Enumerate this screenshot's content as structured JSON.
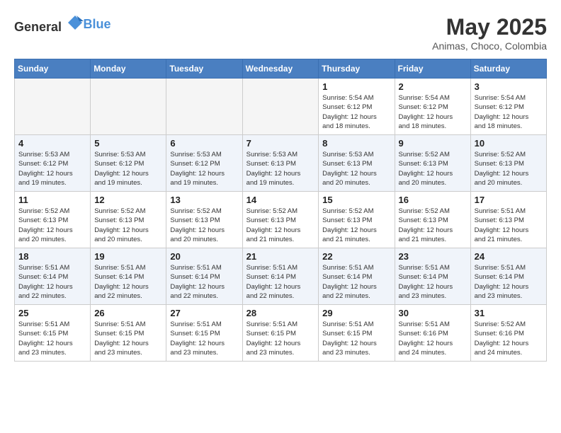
{
  "header": {
    "logo_general": "General",
    "logo_blue": "Blue",
    "title": "May 2025",
    "subtitle": "Animas, Choco, Colombia"
  },
  "weekdays": [
    "Sunday",
    "Monday",
    "Tuesday",
    "Wednesday",
    "Thursday",
    "Friday",
    "Saturday"
  ],
  "weeks": [
    [
      {
        "day": "",
        "info": "",
        "empty": true
      },
      {
        "day": "",
        "info": "",
        "empty": true
      },
      {
        "day": "",
        "info": "",
        "empty": true
      },
      {
        "day": "",
        "info": "",
        "empty": true
      },
      {
        "day": "1",
        "info": "Sunrise: 5:54 AM\nSunset: 6:12 PM\nDaylight: 12 hours\nand 18 minutes."
      },
      {
        "day": "2",
        "info": "Sunrise: 5:54 AM\nSunset: 6:12 PM\nDaylight: 12 hours\nand 18 minutes."
      },
      {
        "day": "3",
        "info": "Sunrise: 5:54 AM\nSunset: 6:12 PM\nDaylight: 12 hours\nand 18 minutes."
      }
    ],
    [
      {
        "day": "4",
        "info": "Sunrise: 5:53 AM\nSunset: 6:12 PM\nDaylight: 12 hours\nand 19 minutes."
      },
      {
        "day": "5",
        "info": "Sunrise: 5:53 AM\nSunset: 6:12 PM\nDaylight: 12 hours\nand 19 minutes."
      },
      {
        "day": "6",
        "info": "Sunrise: 5:53 AM\nSunset: 6:12 PM\nDaylight: 12 hours\nand 19 minutes."
      },
      {
        "day": "7",
        "info": "Sunrise: 5:53 AM\nSunset: 6:13 PM\nDaylight: 12 hours\nand 19 minutes."
      },
      {
        "day": "8",
        "info": "Sunrise: 5:53 AM\nSunset: 6:13 PM\nDaylight: 12 hours\nand 20 minutes."
      },
      {
        "day": "9",
        "info": "Sunrise: 5:52 AM\nSunset: 6:13 PM\nDaylight: 12 hours\nand 20 minutes."
      },
      {
        "day": "10",
        "info": "Sunrise: 5:52 AM\nSunset: 6:13 PM\nDaylight: 12 hours\nand 20 minutes."
      }
    ],
    [
      {
        "day": "11",
        "info": "Sunrise: 5:52 AM\nSunset: 6:13 PM\nDaylight: 12 hours\nand 20 minutes."
      },
      {
        "day": "12",
        "info": "Sunrise: 5:52 AM\nSunset: 6:13 PM\nDaylight: 12 hours\nand 20 minutes."
      },
      {
        "day": "13",
        "info": "Sunrise: 5:52 AM\nSunset: 6:13 PM\nDaylight: 12 hours\nand 20 minutes."
      },
      {
        "day": "14",
        "info": "Sunrise: 5:52 AM\nSunset: 6:13 PM\nDaylight: 12 hours\nand 21 minutes."
      },
      {
        "day": "15",
        "info": "Sunrise: 5:52 AM\nSunset: 6:13 PM\nDaylight: 12 hours\nand 21 minutes."
      },
      {
        "day": "16",
        "info": "Sunrise: 5:52 AM\nSunset: 6:13 PM\nDaylight: 12 hours\nand 21 minutes."
      },
      {
        "day": "17",
        "info": "Sunrise: 5:51 AM\nSunset: 6:13 PM\nDaylight: 12 hours\nand 21 minutes."
      }
    ],
    [
      {
        "day": "18",
        "info": "Sunrise: 5:51 AM\nSunset: 6:14 PM\nDaylight: 12 hours\nand 22 minutes."
      },
      {
        "day": "19",
        "info": "Sunrise: 5:51 AM\nSunset: 6:14 PM\nDaylight: 12 hours\nand 22 minutes."
      },
      {
        "day": "20",
        "info": "Sunrise: 5:51 AM\nSunset: 6:14 PM\nDaylight: 12 hours\nand 22 minutes."
      },
      {
        "day": "21",
        "info": "Sunrise: 5:51 AM\nSunset: 6:14 PM\nDaylight: 12 hours\nand 22 minutes."
      },
      {
        "day": "22",
        "info": "Sunrise: 5:51 AM\nSunset: 6:14 PM\nDaylight: 12 hours\nand 22 minutes."
      },
      {
        "day": "23",
        "info": "Sunrise: 5:51 AM\nSunset: 6:14 PM\nDaylight: 12 hours\nand 23 minutes."
      },
      {
        "day": "24",
        "info": "Sunrise: 5:51 AM\nSunset: 6:14 PM\nDaylight: 12 hours\nand 23 minutes."
      }
    ],
    [
      {
        "day": "25",
        "info": "Sunrise: 5:51 AM\nSunset: 6:15 PM\nDaylight: 12 hours\nand 23 minutes."
      },
      {
        "day": "26",
        "info": "Sunrise: 5:51 AM\nSunset: 6:15 PM\nDaylight: 12 hours\nand 23 minutes."
      },
      {
        "day": "27",
        "info": "Sunrise: 5:51 AM\nSunset: 6:15 PM\nDaylight: 12 hours\nand 23 minutes."
      },
      {
        "day": "28",
        "info": "Sunrise: 5:51 AM\nSunset: 6:15 PM\nDaylight: 12 hours\nand 23 minutes."
      },
      {
        "day": "29",
        "info": "Sunrise: 5:51 AM\nSunset: 6:15 PM\nDaylight: 12 hours\nand 23 minutes."
      },
      {
        "day": "30",
        "info": "Sunrise: 5:51 AM\nSunset: 6:16 PM\nDaylight: 12 hours\nand 24 minutes."
      },
      {
        "day": "31",
        "info": "Sunrise: 5:52 AM\nSunset: 6:16 PM\nDaylight: 12 hours\nand 24 minutes."
      }
    ]
  ]
}
